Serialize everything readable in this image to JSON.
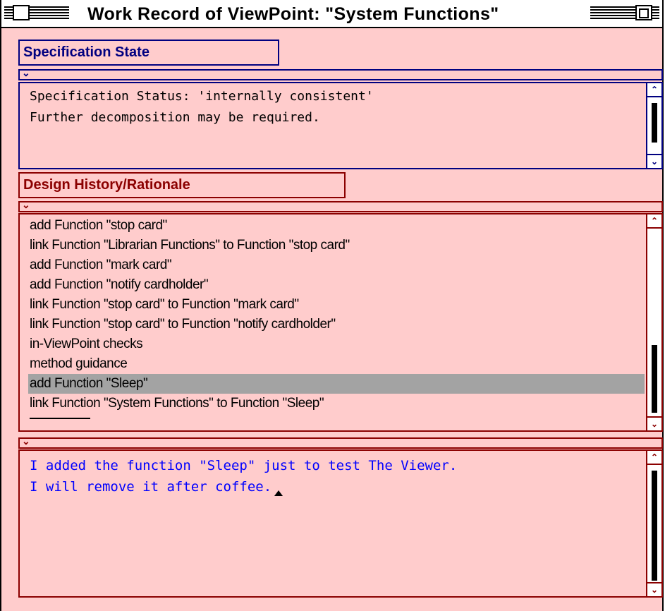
{
  "window": {
    "title": "Work Record of ViewPoint: \"System Functions\""
  },
  "state": {
    "header": "Specification State",
    "lines": [
      "Specification Status: 'internally consistent'",
      "Further decomposition may be required."
    ]
  },
  "history": {
    "header": "Design History/Rationale",
    "items": [
      "add Function \"stop card\"",
      "link Function \"Librarian Functions\" to Function \"stop card\"",
      "add Function \"mark card\"",
      "add Function \"notify cardholder\"",
      "link Function \"stop card\" to Function \"mark card\"",
      "link Function \"stop card\" to Function \"notify cardholder\"",
      "in-ViewPoint checks",
      "method guidance",
      "add Function \"Sleep\"",
      "link Function \"System Functions\" to Function \"Sleep\""
    ],
    "selected_index": 8
  },
  "note": {
    "lines": [
      "I added the function \"Sleep\" just to test The Viewer.",
      "I will remove it after coffee."
    ]
  },
  "icons": {
    "collapse": "chevron-down-icon",
    "scroll_up": "scroll-up-arrow-icon",
    "scroll_down": "scroll-down-arrow-icon",
    "text_cursor": "text-cursor-icon"
  },
  "colors": {
    "background": "#ffcccc",
    "state_accent": "#000080",
    "history_accent": "#8b0000",
    "note_text": "#0000ff",
    "selection": "#a3a3a3"
  }
}
